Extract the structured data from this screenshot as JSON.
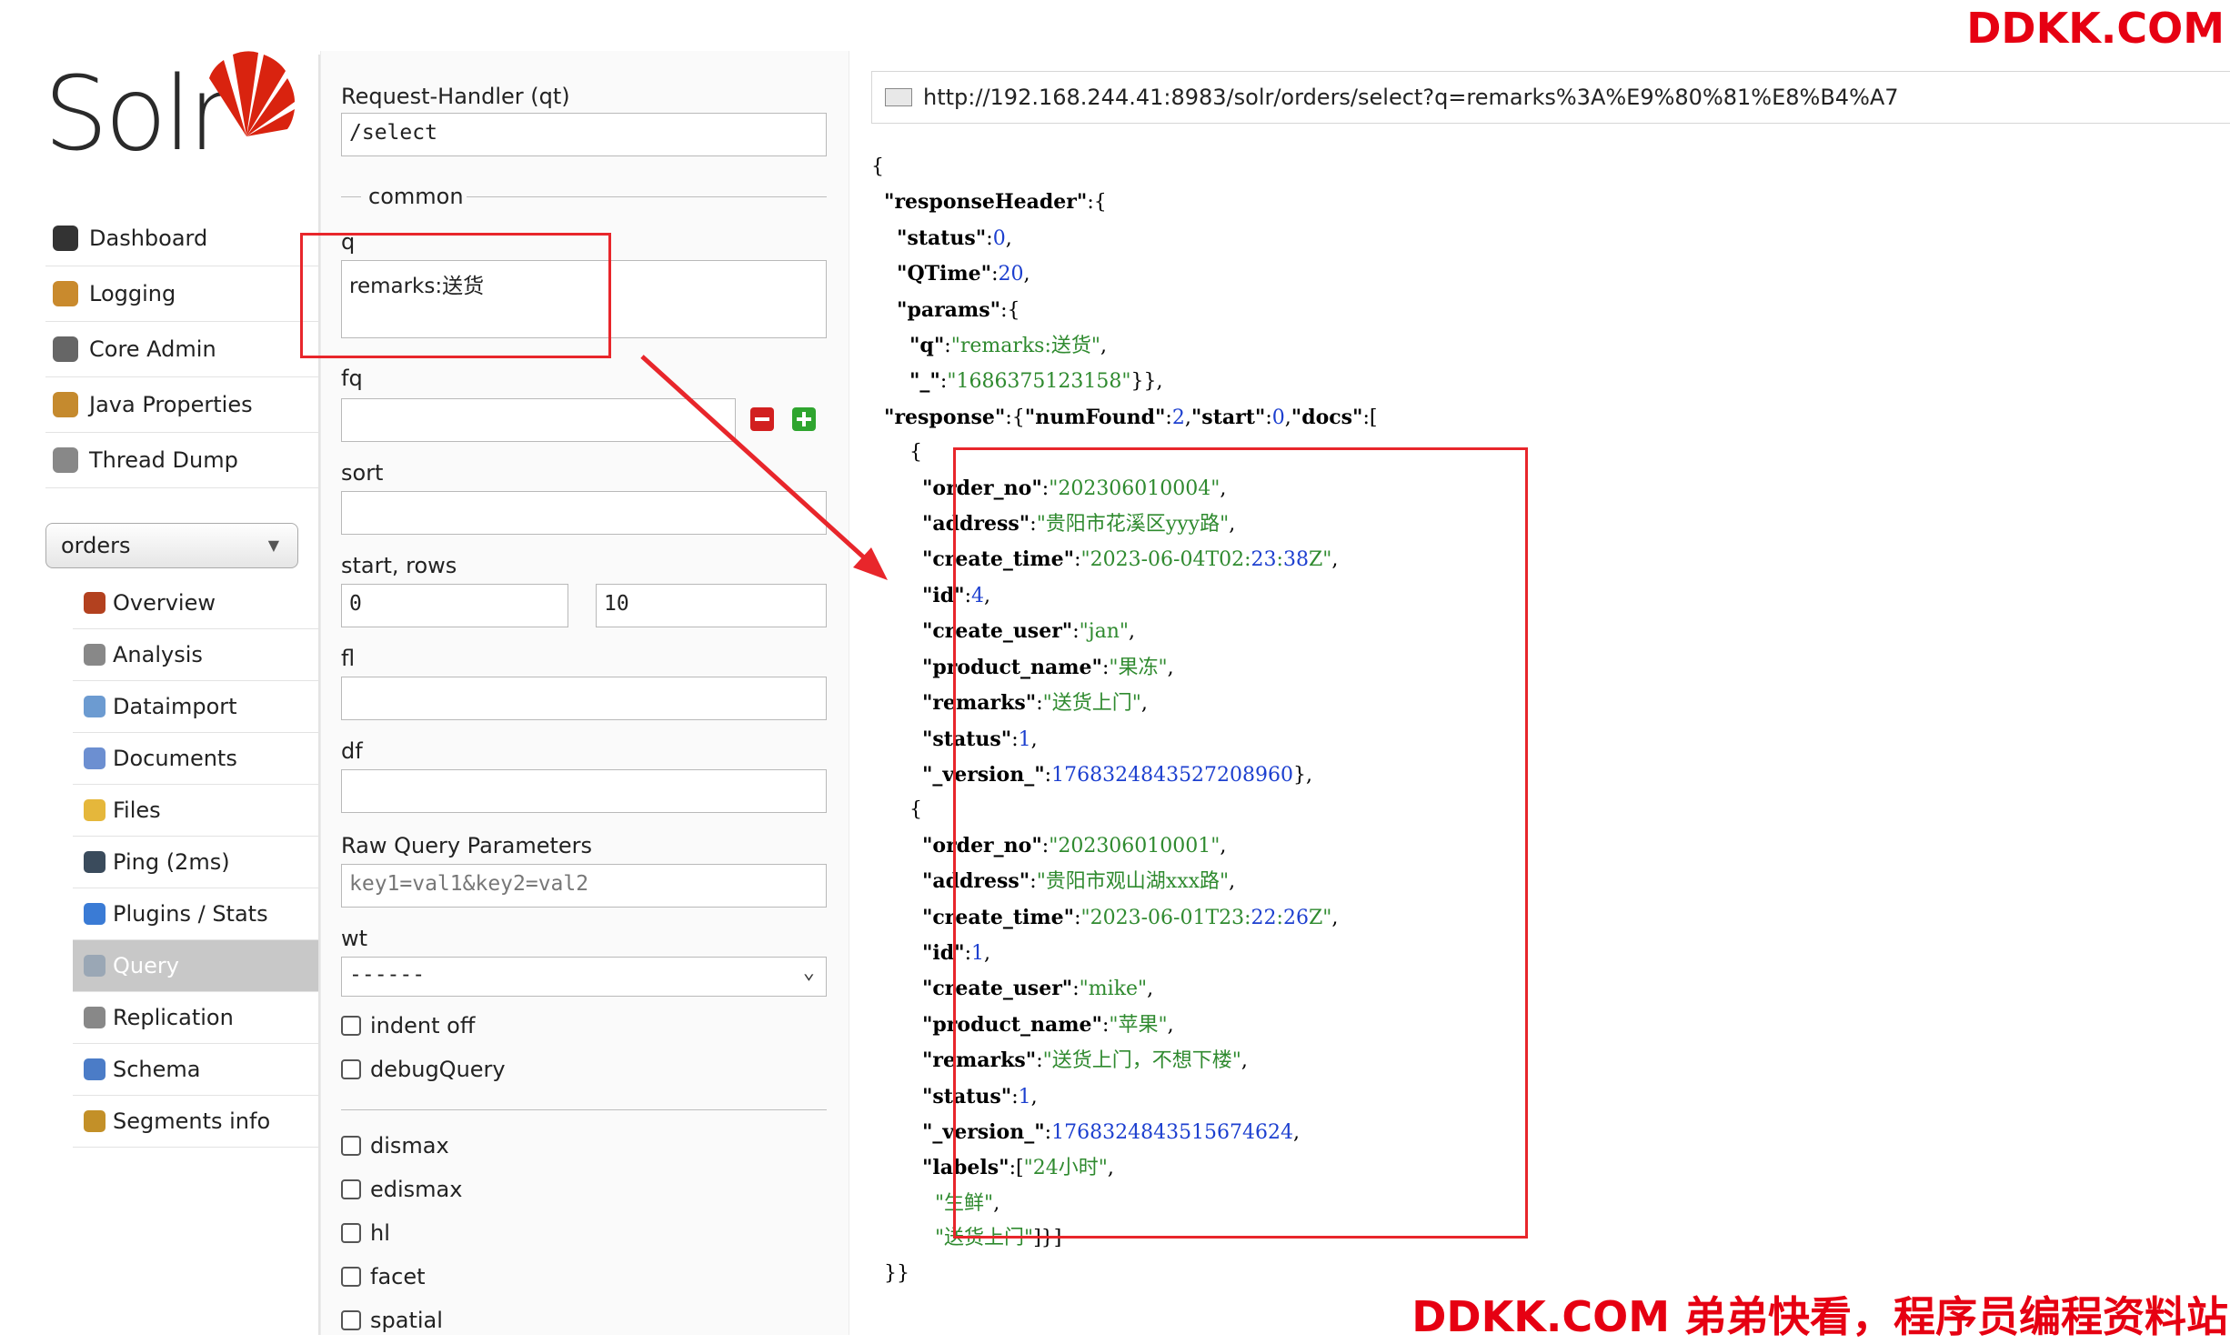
{
  "watermark": {
    "top": "DDKK.COM",
    "bottom": "DDKK.COM 弟弟快看，程序员编程资料站"
  },
  "logo": {
    "text": "Solr"
  },
  "nav": [
    {
      "label": "Dashboard",
      "icon": "dashboard-icon"
    },
    {
      "label": "Logging",
      "icon": "logging-icon"
    },
    {
      "label": "Core Admin",
      "icon": "core-admin-icon"
    },
    {
      "label": "Java Properties",
      "icon": "java-icon"
    },
    {
      "label": "Thread Dump",
      "icon": "thread-dump-icon"
    }
  ],
  "core_selector": {
    "value": "orders"
  },
  "core_nav": [
    {
      "label": "Overview",
      "icon": "home-icon"
    },
    {
      "label": "Analysis",
      "icon": "funnel-icon"
    },
    {
      "label": "Dataimport",
      "icon": "import-icon"
    },
    {
      "label": "Documents",
      "icon": "documents-icon"
    },
    {
      "label": "Files",
      "icon": "folder-icon"
    },
    {
      "label": "Ping (2ms)",
      "icon": "ping-icon"
    },
    {
      "label": "Plugins / Stats",
      "icon": "plugins-icon"
    },
    {
      "label": "Query",
      "icon": "query-icon",
      "active": true
    },
    {
      "label": "Replication",
      "icon": "replication-icon"
    },
    {
      "label": "Schema",
      "icon": "schema-icon"
    },
    {
      "label": "Segments info",
      "icon": "segments-icon"
    }
  ],
  "form": {
    "request_handler_label": "Request-Handler (qt)",
    "request_handler_value": "/select",
    "common_legend": "common",
    "q_label": "q",
    "q_value": "remarks:送货",
    "fq_label": "fq",
    "fq_value": "",
    "sort_label": "sort",
    "sort_value": "",
    "start_rows_label": "start, rows",
    "start_value": "0",
    "rows_value": "10",
    "fl_label": "fl",
    "fl_value": "",
    "df_label": "df",
    "df_value": "",
    "raw_label": "Raw Query Parameters",
    "raw_placeholder": "key1=val1&key2=val2",
    "wt_label": "wt",
    "wt_value": "------",
    "indent_label": "indent off",
    "debug_label": "debugQuery",
    "dismax_label": "dismax",
    "edismax_label": "edismax",
    "hl_label": "hl",
    "facet_label": "facet",
    "spatial_label": "spatial"
  },
  "response": {
    "url": "http://192.168.244.41:8983/solr/orders/select?q=remarks%3A%E9%80%81%E8%B4%A7",
    "lines": [
      "{",
      "  \"responseHeader\":{",
      "    \"status\":0,",
      "    \"QTime\":20,",
      "    \"params\":{",
      "      \"q\":\"remarks:送货\",",
      "      \"_\":\"1686375123158\"}},",
      "  \"response\":{\"numFound\":2,\"start\":0,\"docs\":[",
      "      {",
      "        \"order_no\":\"202306010004\",",
      "        \"address\":\"贵阳市花溪区yyy路\",",
      "        \"create_time\":\"2023-06-04T02:23:38Z\",",
      "        \"id\":4,",
      "        \"create_user\":\"jan\",",
      "        \"product_name\":\"果冻\",",
      "        \"remarks\":\"送货上门\",",
      "        \"status\":1,",
      "        \"_version_\":1768324843527208960},",
      "      {",
      "        \"order_no\":\"202306010001\",",
      "        \"address\":\"贵阳市观山湖xxx路\",",
      "        \"create_time\":\"2023-06-01T23:22:26Z\",",
      "        \"id\":1,",
      "        \"create_user\":\"mike\",",
      "        \"product_name\":\"苹果\",",
      "        \"remarks\":\"送货上门，不想下楼\",",
      "        \"status\":1,",
      "        \"_version_\":1768324843515674624,",
      "        \"labels\":[\"24小时\",",
      "          \"生鲜\",",
      "          \"送货上门\"]}]",
      "  }}"
    ]
  },
  "colors": {
    "highlight": "#e8262b",
    "json_string": "#2f8a2f",
    "json_number": "#1c3fcf",
    "watermark": "#e60012"
  }
}
